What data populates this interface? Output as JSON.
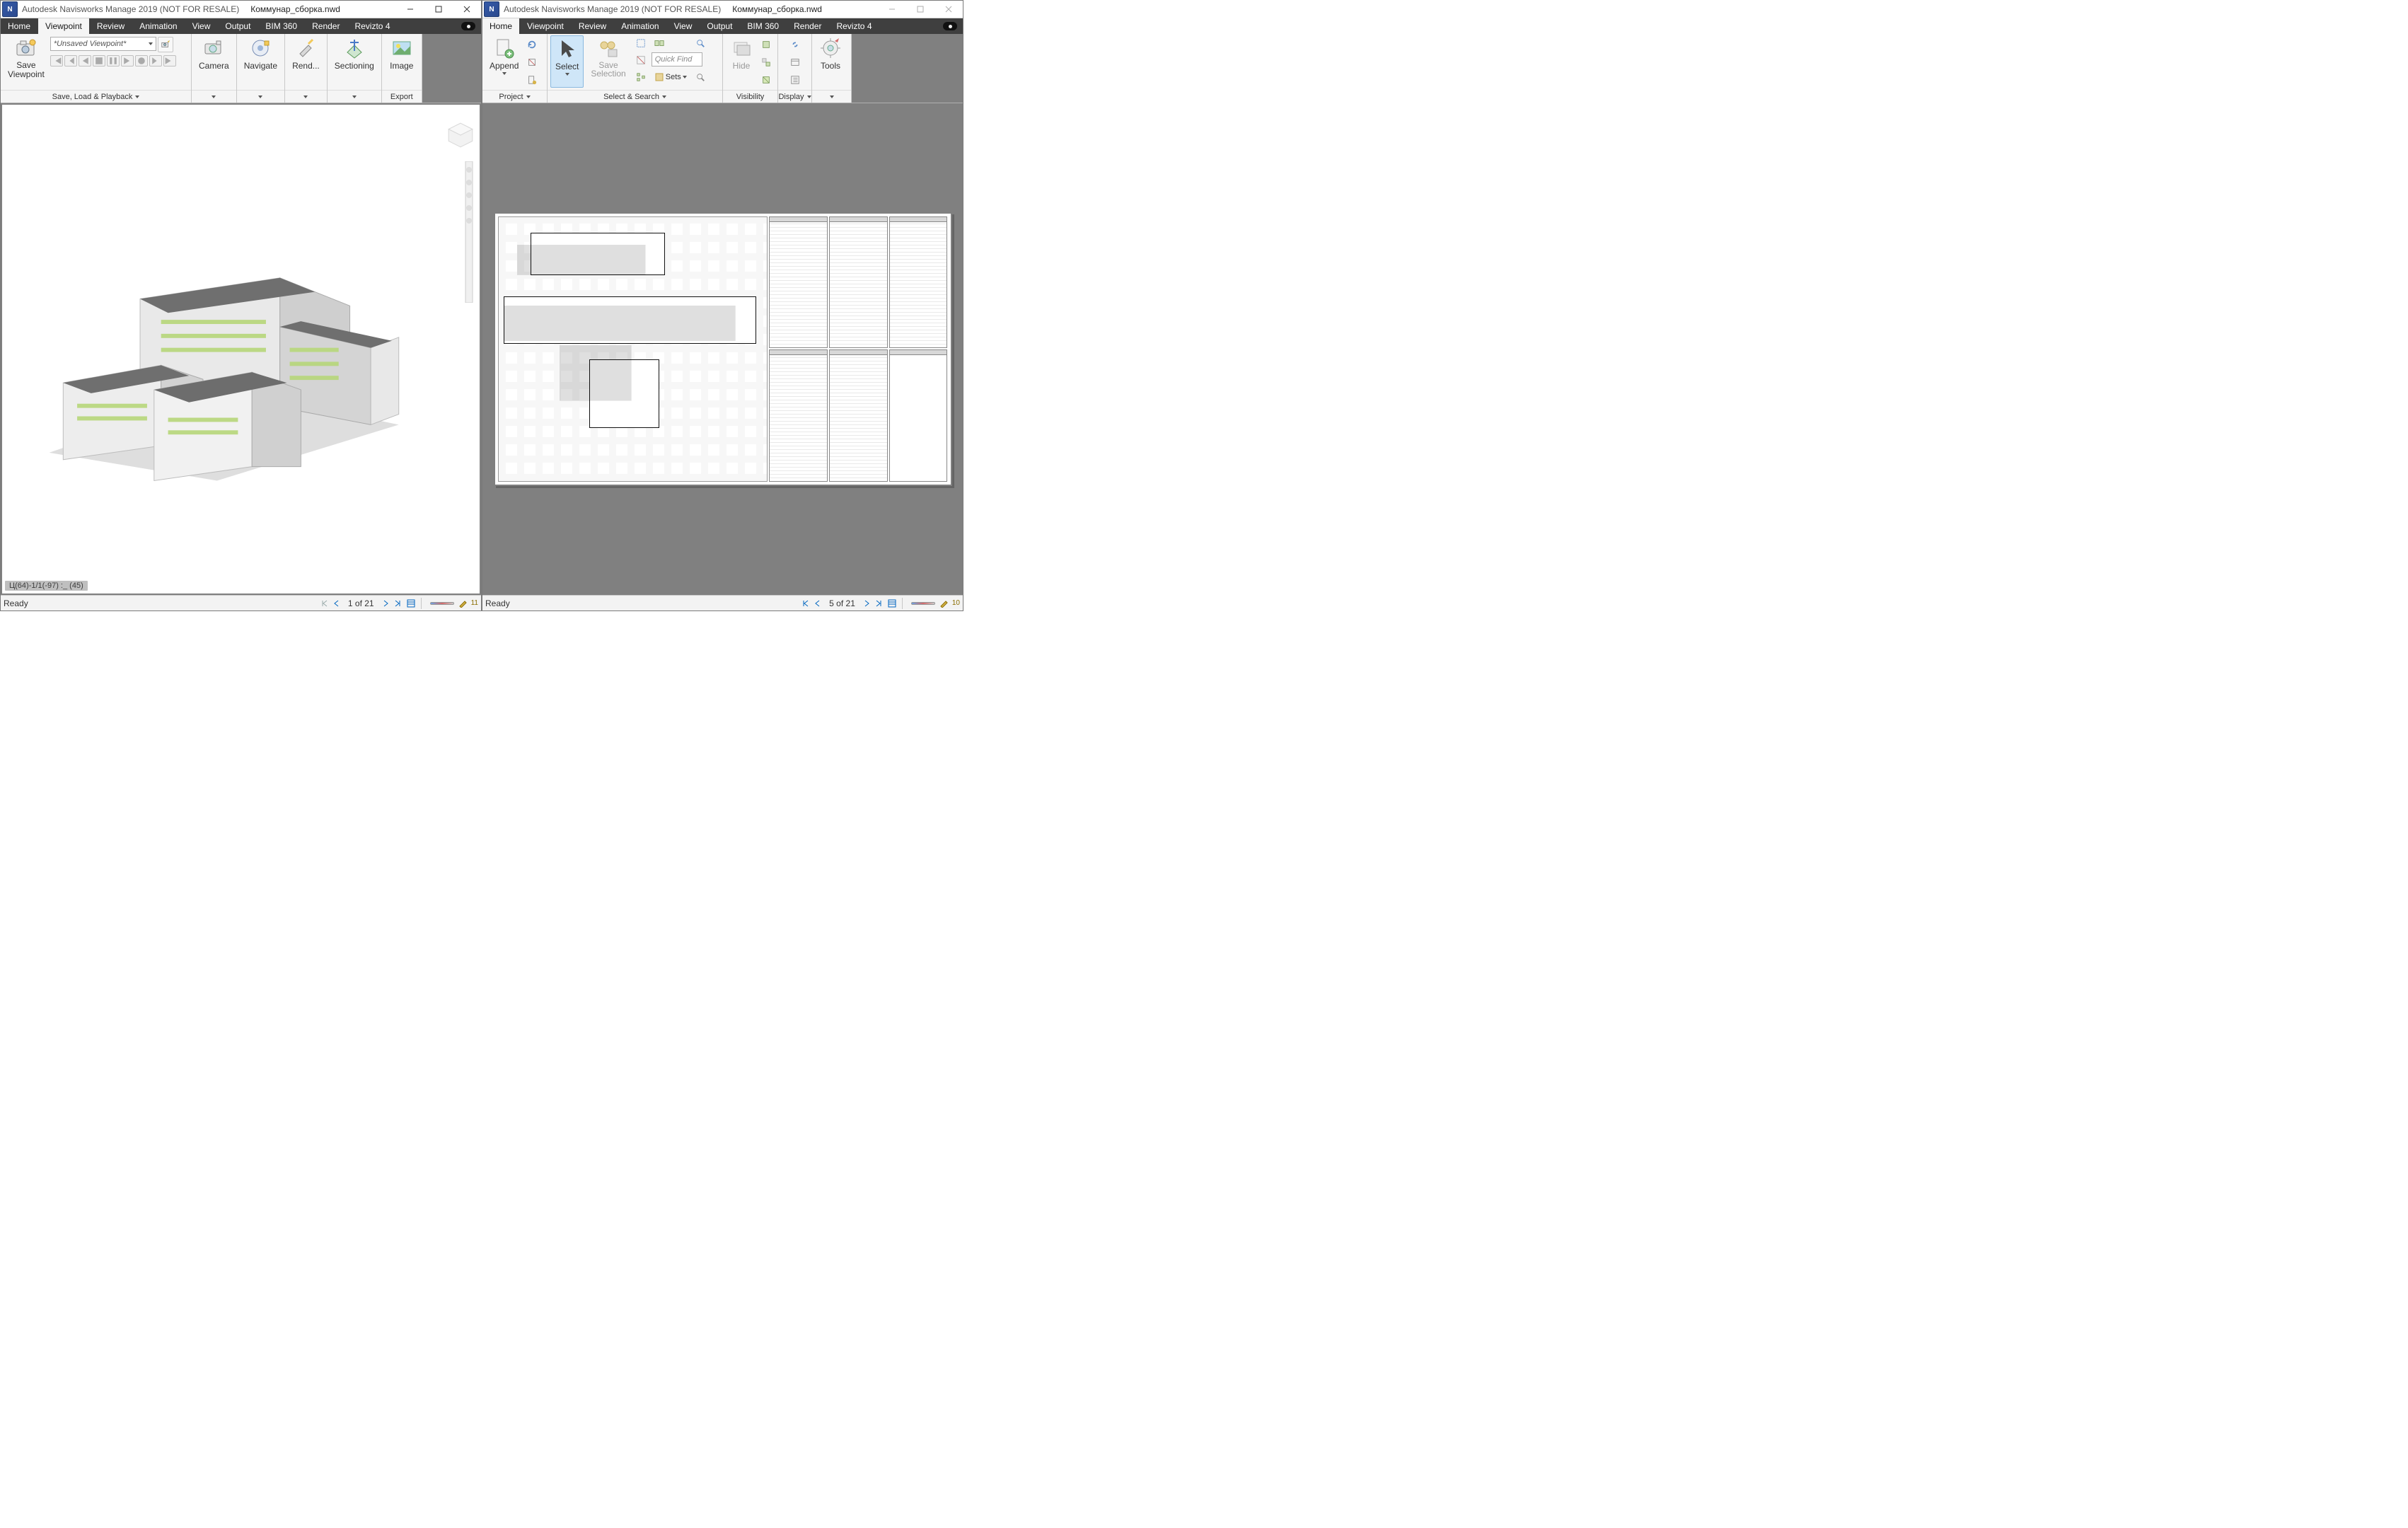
{
  "left": {
    "title_app": "Autodesk Navisworks Manage 2019 (NOT FOR RESALE)",
    "title_file": "Коммунар_сборка.nwd",
    "tabs": [
      "Home",
      "Viewpoint",
      "Review",
      "Animation",
      "View",
      "Output",
      "BIM 360",
      "Render",
      "Revizto 4"
    ],
    "active_tab": "Viewpoint",
    "ribbon": {
      "save_viewpoint": "Save\nViewpoint",
      "viewpoint_combo": "*Unsaved Viewpoint*",
      "group_save_caption": "Save, Load & Playback",
      "camera": "Camera",
      "navigate": "Navigate",
      "render": "Rend...",
      "sectioning": "Sectioning",
      "image": "Image",
      "export_caption": "Export"
    },
    "coord": "Ц(64)-1/1(-97) :_  (45)",
    "status_ready": "Ready",
    "sheet_pos": "1 of 21",
    "pencils": "11"
  },
  "right": {
    "title_app": "Autodesk Navisworks Manage 2019 (NOT FOR RESALE)",
    "title_file": "Коммунар_сборка.nwd",
    "tabs": [
      "Home",
      "Viewpoint",
      "Review",
      "Animation",
      "View",
      "Output",
      "BIM 360",
      "Render",
      "Revizto 4"
    ],
    "active_tab": "Home",
    "ribbon": {
      "append": "Append",
      "project_caption": "Project",
      "select": "Select",
      "save_selection": "Save\nSelection",
      "quick_find": "Quick Find",
      "sets_label": "Sets",
      "select_search_caption": "Select & Search",
      "hide": "Hide",
      "visibility_caption": "Visibility",
      "display_caption": "Display",
      "tools": "Tools"
    },
    "status_ready": "Ready",
    "sheet_pos": "5 of 21",
    "pencils": "10"
  }
}
